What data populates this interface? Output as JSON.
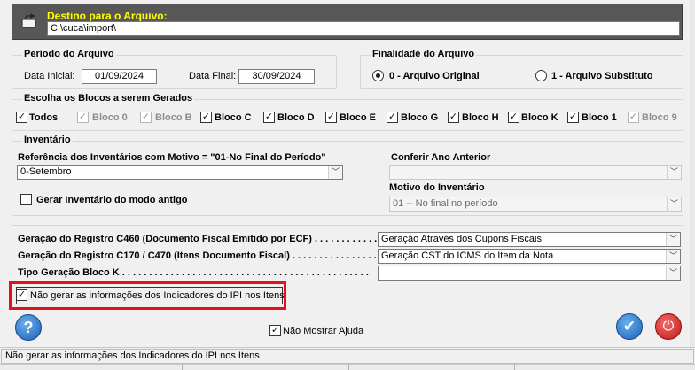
{
  "destination": {
    "label": "Destino para o Arquivo:",
    "path": "C:\\cuca\\import\\"
  },
  "period": {
    "title": "Período do Arquivo",
    "start_label": "Data Inicial:",
    "start_value": "01/09/2024",
    "end_label": "Data Final:",
    "end_value": "30/09/2024"
  },
  "purpose": {
    "title": "Finalidade do Arquivo",
    "options": [
      {
        "label": "0 - Arquivo Original",
        "selected": true
      },
      {
        "label": "1 - Arquivo Substituto",
        "selected": false
      }
    ]
  },
  "blocks": {
    "title": "Escolha os Blocos a serem Gerados",
    "items": [
      {
        "label": "Todos",
        "checked": true,
        "enabled": true
      },
      {
        "label": "Bloco 0",
        "checked": true,
        "enabled": false
      },
      {
        "label": "Bloco B",
        "checked": true,
        "enabled": false
      },
      {
        "label": "Bloco C",
        "checked": true,
        "enabled": true
      },
      {
        "label": "Bloco D",
        "checked": true,
        "enabled": true
      },
      {
        "label": "Bloco E",
        "checked": true,
        "enabled": true
      },
      {
        "label": "Bloco G",
        "checked": true,
        "enabled": true
      },
      {
        "label": "Bloco H",
        "checked": true,
        "enabled": true
      },
      {
        "label": "Bloco K",
        "checked": true,
        "enabled": true
      },
      {
        "label": "Bloco 1",
        "checked": true,
        "enabled": true
      },
      {
        "label": "Bloco 9",
        "checked": true,
        "enabled": false
      }
    ]
  },
  "inventory": {
    "title": "Inventário",
    "reference_label": "Referência dos Inventários com Motivo = \"01-No Final do Período\"",
    "reference_value": "0-Setembro",
    "old_mode_label": "Gerar Inventário do modo antigo",
    "old_mode_checked": false,
    "prev_year_label": "Conferir Ano Anterior",
    "prev_year_value": "",
    "reason_label": "Motivo do Inventário",
    "reason_value": "01 -- No final no período"
  },
  "registers": {
    "c460_label": "Geração do Registro C460 (Documento Fiscal Emitido por ECF) . . . . . . . . . . . . . . .",
    "c460_value": "Geração Através dos Cupons Fiscais",
    "c170_label": "Geração do Registro C170 / C470 (Itens Documento Fiscal) . . . . . . . . . . . . . . . . . .",
    "c170_value": "Geração CST do ICMS do Item da Nota",
    "blockk_label": "Tipo Geração Bloco K . . . . . . . . . . . . . . . . . . . . . . . . . . . . . . . . . . . . . . . . . . . . . .",
    "blockk_value": ""
  },
  "ipi": {
    "label": "Não gerar as informações dos Indicadores do IPI nos Itens",
    "checked": true
  },
  "footer": {
    "help_glyph": "?",
    "hide_help_label": "Não Mostrar Ajuda",
    "hide_help_checked": true,
    "status_text": "Não gerar as informações dos Indicadores do IPI nos Itens"
  },
  "colors": {
    "header_bg": "#575757",
    "header_label": "#ffff00",
    "highlight": "#e1141c",
    "help_button": "#1a5fb4",
    "exit_button": "#c01818"
  },
  "icons": [
    "folder-icon",
    "help-icon",
    "check-icon",
    "power-icon",
    "chevron-down-icon"
  ]
}
